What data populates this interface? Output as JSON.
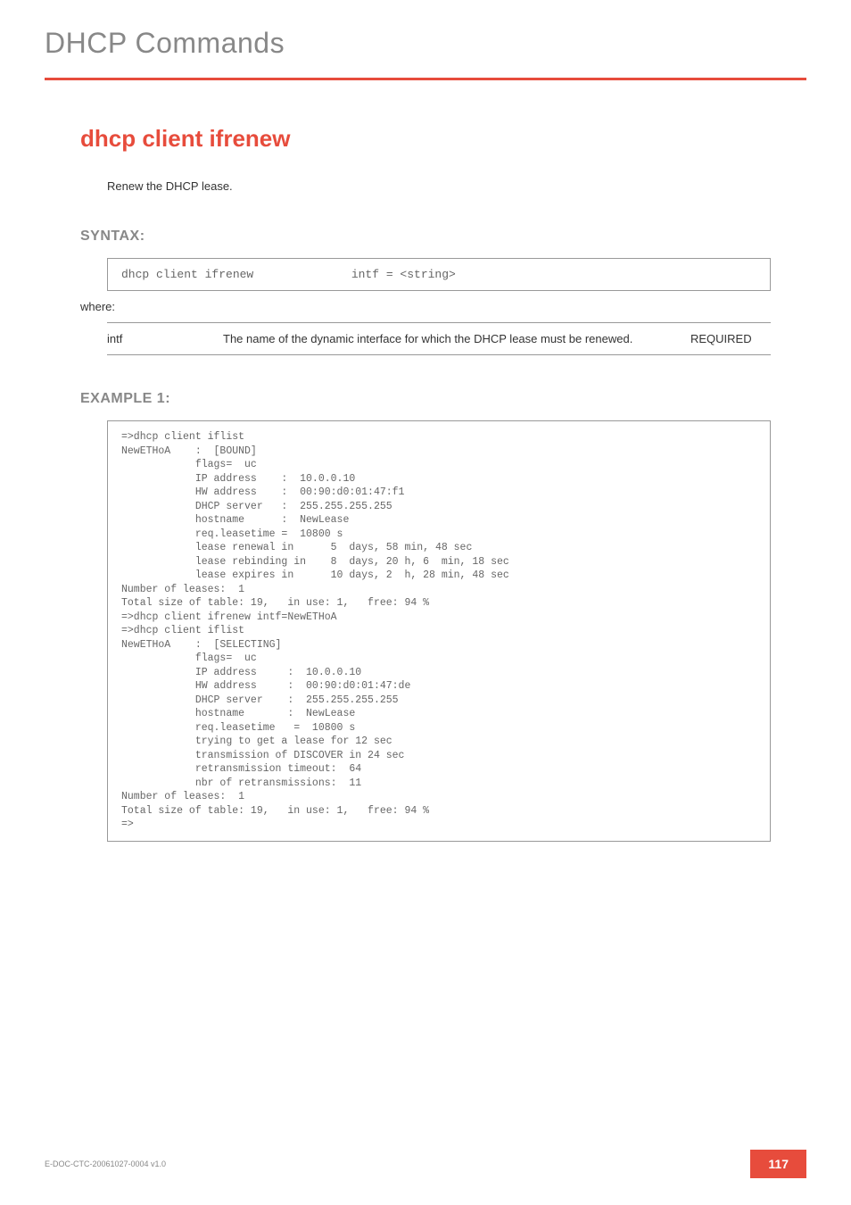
{
  "header": {
    "page_title": "DHCP Commands"
  },
  "command": {
    "title": "dhcp client ifrenew",
    "description": "Renew the DHCP lease."
  },
  "syntax": {
    "heading": "SYNTAX:",
    "command": "dhcp client ifrenew",
    "args": "intf = <string>",
    "where_label": "where:",
    "params": [
      {
        "name": "intf",
        "desc": "The name of the dynamic interface for which the DHCP lease must be renewed.",
        "req": "REQUIRED"
      }
    ]
  },
  "example": {
    "heading": "EXAMPLE 1:",
    "code": "=>dhcp client iflist\nNewETHoA    :  [BOUND]\n            flags=  uc\n            IP address    :  10.0.0.10\n            HW address    :  00:90:d0:01:47:f1\n            DHCP server   :  255.255.255.255\n            hostname      :  NewLease\n            req.leasetime =  10800 s\n            lease renewal in      5  days, 58 min, 48 sec\n            lease rebinding in    8  days, 20 h, 6  min, 18 sec\n            lease expires in      10 days, 2  h, 28 min, 48 sec\nNumber of leases:  1\nTotal size of table: 19,   in use: 1,   free: 94 %\n=>dhcp client ifrenew intf=NewETHoA\n=>dhcp client iflist\nNewETHoA    :  [SELECTING]\n            flags=  uc\n            IP address     :  10.0.0.10\n            HW address     :  00:90:d0:01:47:de\n            DHCP server    :  255.255.255.255\n            hostname       :  NewLease\n            req.leasetime   =  10800 s\n            trying to get a lease for 12 sec\n            transmission of DISCOVER in 24 sec\n            retransmission timeout:  64\n            nbr of retransmissions:  11\nNumber of leases:  1\nTotal size of table: 19,   in use: 1,   free: 94 %\n=>"
  },
  "footer": {
    "doc_id": "E-DOC-CTC-20061027-0004 v1.0",
    "page_number": "117"
  }
}
